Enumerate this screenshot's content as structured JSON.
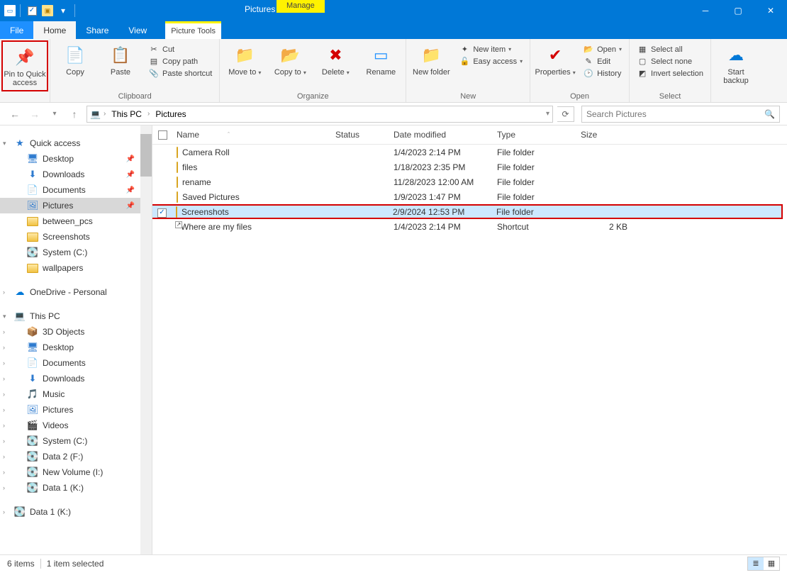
{
  "window": {
    "title": "Pictures",
    "manage_label": "Manage",
    "picture_tools": "Picture Tools"
  },
  "tabs": {
    "file": "File",
    "home": "Home",
    "share": "Share",
    "view": "View"
  },
  "ribbon": {
    "pin": "Pin to Quick access",
    "copy": "Copy",
    "paste": "Paste",
    "cut": "Cut",
    "copy_path": "Copy path",
    "paste_shortcut": "Paste shortcut",
    "clipboard": "Clipboard",
    "move_to": "Move to",
    "copy_to": "Copy to",
    "delete": "Delete",
    "rename": "Rename",
    "organize": "Organize",
    "new_folder": "New folder",
    "new_item": "New item",
    "easy_access": "Easy access",
    "new": "New",
    "properties": "Properties",
    "open": "Open",
    "edit": "Edit",
    "history": "History",
    "open_group": "Open",
    "select_all": "Select all",
    "select_none": "Select none",
    "invert_selection": "Invert selection",
    "select": "Select",
    "start_backup": "Start backup"
  },
  "breadcrumb": {
    "this_pc": "This PC",
    "pictures": "Pictures"
  },
  "search": {
    "placeholder": "Search Pictures"
  },
  "columns": {
    "name": "Name",
    "status": "Status",
    "date": "Date modified",
    "type": "Type",
    "size": "Size"
  },
  "tree": {
    "quick_access": "Quick access",
    "desktop": "Desktop",
    "downloads": "Downloads",
    "documents": "Documents",
    "pictures": "Pictures",
    "between_pcs": "between_pcs",
    "screenshots": "Screenshots",
    "system_c": "System (C:)",
    "wallpapers": "wallpapers",
    "onedrive": "OneDrive - Personal",
    "this_pc": "This PC",
    "objects_3d": "3D Objects",
    "desktop2": "Desktop",
    "documents2": "Documents",
    "downloads2": "Downloads",
    "music": "Music",
    "pictures2": "Pictures",
    "videos": "Videos",
    "system_c2": "System (C:)",
    "data2_f": "Data 2 (F:)",
    "newvol_i": "New Volume (I:)",
    "data1_k": "Data 1 (K:)",
    "data1_k2": "Data 1 (K:)"
  },
  "files": [
    {
      "name": "Camera Roll",
      "date": "1/4/2023 2:14 PM",
      "type": "File folder",
      "size": "",
      "icon": "folder",
      "selected": false
    },
    {
      "name": "files",
      "date": "1/18/2023 2:35 PM",
      "type": "File folder",
      "size": "",
      "icon": "folder",
      "selected": false
    },
    {
      "name": "rename",
      "date": "11/28/2023 12:00 AM",
      "type": "File folder",
      "size": "",
      "icon": "folder",
      "selected": false
    },
    {
      "name": "Saved Pictures",
      "date": "1/9/2023 1:47 PM",
      "type": "File folder",
      "size": "",
      "icon": "folder",
      "selected": false
    },
    {
      "name": "Screenshots",
      "date": "2/9/2024 12:53 PM",
      "type": "File folder",
      "size": "",
      "icon": "folder",
      "selected": true
    },
    {
      "name": "Where are my files",
      "date": "1/4/2023 2:14 PM",
      "type": "Shortcut",
      "size": "2 KB",
      "icon": "shortcut",
      "selected": false
    }
  ],
  "status": {
    "count": "6 items",
    "selected": "1 item selected"
  }
}
